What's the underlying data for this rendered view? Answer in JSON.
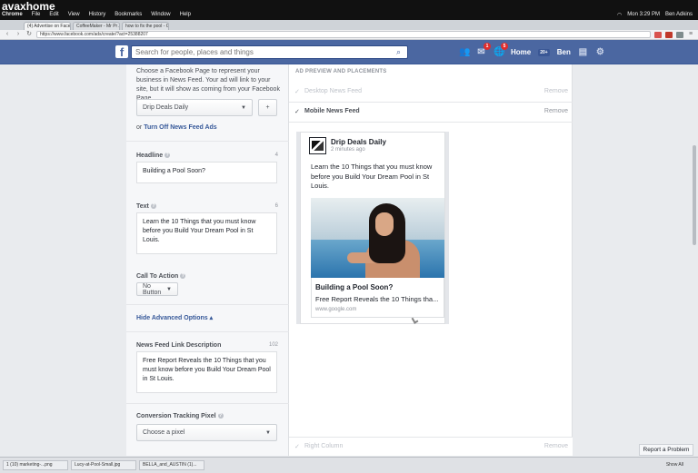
{
  "watermark": "avaxhome",
  "os": {
    "menu": [
      "Chrome",
      "File",
      "Edit",
      "View",
      "History",
      "Bookmarks",
      "Window",
      "Help"
    ],
    "clock": "Mon 3:29 PM",
    "user": "Ben Adkins"
  },
  "browser": {
    "tabs": [
      "(4) Advertise on Facebook",
      "CoffeeMaker - Mr Pr…",
      "how to fix the pool - Google"
    ],
    "address": "https://www.facebook.com/ads/create/?act=25388207"
  },
  "fb": {
    "search_placeholder": "Search for people, places and things",
    "messages_badge": "1",
    "notifications_badge": "5",
    "home_label": "Home",
    "home_count": "20+",
    "user_label": "Ben"
  },
  "left": {
    "intro": "Choose a Facebook Page to represent your business in News Feed. Your ad will link to your site, but it will show as coming from your Facebook Page.",
    "page_select": "Drip Deals Daily",
    "add_button": "+",
    "or": "or",
    "turn_off_link": "Turn Off News Feed Ads",
    "headline_label": "Headline",
    "headline_count": "4",
    "headline_value": "Building a Pool Soon?",
    "text_label": "Text",
    "text_count": "6",
    "text_value": "Learn the 10 Things that you must know before you Build Your Dream Pool in St Louis.",
    "cta_label": "Call To Action",
    "cta_value": "No Button",
    "advanced_link": "Hide Advanced Options",
    "link_desc_label": "News Feed Link Description",
    "link_desc_count": "102",
    "link_desc_value": "Free Report Reveals the 10 Things that you must know before you Build Your Dream Pool in St Louis.",
    "pixel_label": "Conversion Tracking Pixel",
    "pixel_value": "Choose a pixel"
  },
  "right": {
    "section_title": "AD PREVIEW AND PLACEMENTS",
    "placements": [
      {
        "label": "Desktop News Feed",
        "remove": "Remove",
        "active": false
      },
      {
        "label": "Mobile News Feed",
        "remove": "Remove",
        "active": true
      }
    ],
    "right_column": {
      "label": "Right Column",
      "remove": "Remove"
    }
  },
  "preview": {
    "page_name": "Drip Deals Daily",
    "time": "2 minutes ago",
    "body": "Learn the 10 Things that you must know before you Build Your Dream Pool in St Louis.",
    "headline": "Building a Pool Soon?",
    "description": "Free Report Reveals the 10 Things tha...",
    "domain": "www.google.com"
  },
  "report_button": "Report a Problem",
  "downloads": [
    "1 (10) marketing-...png",
    "Lucy-at-Pool-Small.jpg",
    "BELLA_and_AUSTIN (1)..."
  ],
  "show_all": "Show All"
}
